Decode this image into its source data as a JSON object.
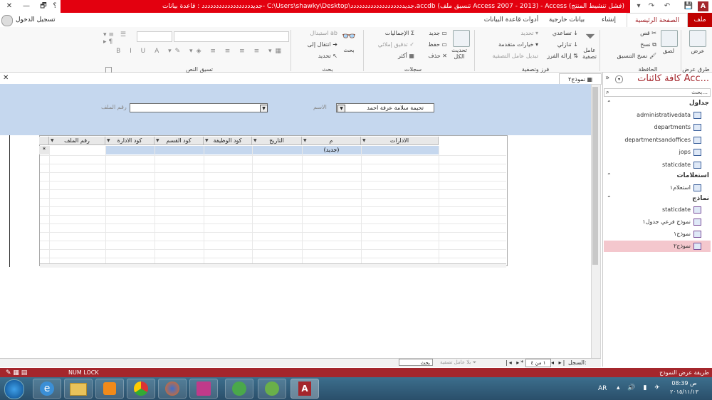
{
  "window": {
    "title": "جديدددددددددددددددددد : قاعدة بيانات- C:\\Users\\shawky\\Desktop\\جديددددددددددددددددددد.accdb (تنسيق ملف Access 2007 - 2013) - Access (فشل تنشيط المنتج)",
    "help_icon": "؟",
    "restore_icon": "🗗",
    "minimize_icon": "—",
    "close_icon": "✕",
    "sign_in": "تسجيل الدخول"
  },
  "quick_access": {
    "save_icon": "💾",
    "undo_icon": "↶",
    "redo_icon": "↷",
    "more_icon": "▾"
  },
  "tabs": [
    "ملف",
    "الصفحة الرئيسية",
    "إنشاء",
    "بيانات خارجية",
    "أدوات قاعدة البيانات"
  ],
  "ribbon": {
    "views": {
      "view_label": "عرض",
      "group": "طرق عرض"
    },
    "clipboard": {
      "paste": "لصق",
      "cut": "قص",
      "copy": "نسخ",
      "format_painter": "نسخ التنسيق",
      "group": "الحافظة"
    },
    "sort_filter": {
      "filter": "عامل تصفية",
      "ascending": "تصاعدي",
      "descending": "تنازلي",
      "remove_sort": "إزالة الفرز",
      "selection": "تحديد",
      "advanced": "خيارات متقدمة",
      "toggle_filter": "تبديل عامل التصفية",
      "group": "فرز وتصفية"
    },
    "records": {
      "refresh_all": "تحديث الكل",
      "new": "جديد",
      "save": "حفظ",
      "delete": "حذف",
      "totals": "الإجماليات",
      "spelling": "تدقيق إملائي",
      "more": "أكثر",
      "group": "سجلات"
    },
    "find": {
      "find": "بحث",
      "replace": "استبدال",
      "goto": "انتقال إلى",
      "select": "تحديد",
      "group": "بحث"
    },
    "text_formatting": {
      "group": "تسيق النص"
    }
  },
  "document_tab": {
    "label": "نموذج٢"
  },
  "form_header": {
    "name_label": "الاسم",
    "name_value": "تحيمة سلامة عرفة احمد",
    "file_number_label": "رقم الملف",
    "file_number_value": ""
  },
  "datasheet": {
    "columns": [
      "الادارات",
      "م",
      "التاريخ",
      "كود الوظيفة",
      "كود القسم",
      "كود الادارة",
      "رقم الملف"
    ],
    "new_row_marker": "*",
    "new_row_value": "(جديد)"
  },
  "nav_pane": {
    "title": "كافة كائنات Acc...",
    "search_placeholder": "بحث...",
    "groups": [
      {
        "name": "جداول",
        "items": [
          "administrativedata",
          "departments",
          "departmentsandoffices",
          "jops",
          "staticdate"
        ]
      },
      {
        "name": "استعلامات",
        "items": [
          "استعلام١"
        ]
      },
      {
        "name": "نماذج",
        "items": [
          "staticdate",
          "نموذج فرعي جدول١",
          "نموذج١",
          "نموذج٢"
        ]
      }
    ],
    "selected_item": "نموذج٢"
  },
  "record_nav": {
    "label": "السجل:",
    "position": "١ من ٤",
    "filter": "بلا عامل تصفية",
    "search": "بحث"
  },
  "status_bar": {
    "left": "طريقة عرض النموذج",
    "num_lock": "NUM LOCK"
  },
  "taskbar": {
    "lang": "AR",
    "time": "08:39 ص",
    "date": "٢٠١٥/١١/١٣"
  }
}
